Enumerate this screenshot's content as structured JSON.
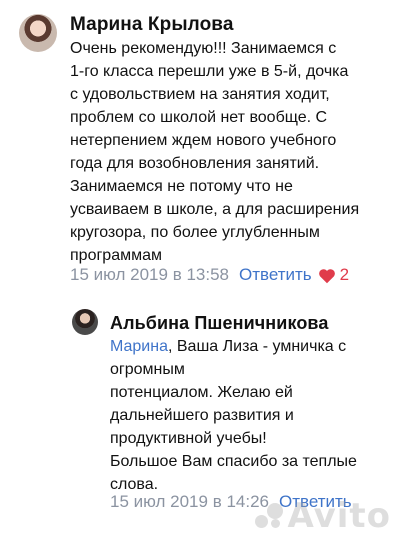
{
  "comments": [
    {
      "author": "Марина Крылова",
      "lines": [
        "Очень рекомендую!!! Занимаемся с",
        "1-го класса перешли уже в 5-й, дочка",
        "с удовольствием на занятия ходит,",
        "проблем со школой нет вообще. С",
        "нетерпением ждем нового учебного",
        "года для возобновления занятий.",
        "Занимаемся не потому что не",
        "усваиваем в школе, а для расширения",
        "кругозора, по более углубленным",
        "программам"
      ],
      "date": "15 июл 2019 в 13:58",
      "reply_label": "Ответить",
      "likes": "2"
    }
  ],
  "reply": {
    "author": "Альбина Пшеничникова",
    "mention": "Марина",
    "first_line_rest": ", Ваша Лиза - умничка с",
    "lines": [
      "огромным",
      "потенциалом. Желаю ей",
      "дальнейшего развития и",
      "продуктивной учебы!",
      "Большое Вам спасибо за теплые",
      "слова."
    ],
    "date": "15 июл 2019 в 14:26",
    "reply_label": "Ответить"
  },
  "watermark": "Avito",
  "colors": {
    "link": "#3f74c9",
    "meta": "#8b93a1",
    "heart": "#e03c4b"
  }
}
